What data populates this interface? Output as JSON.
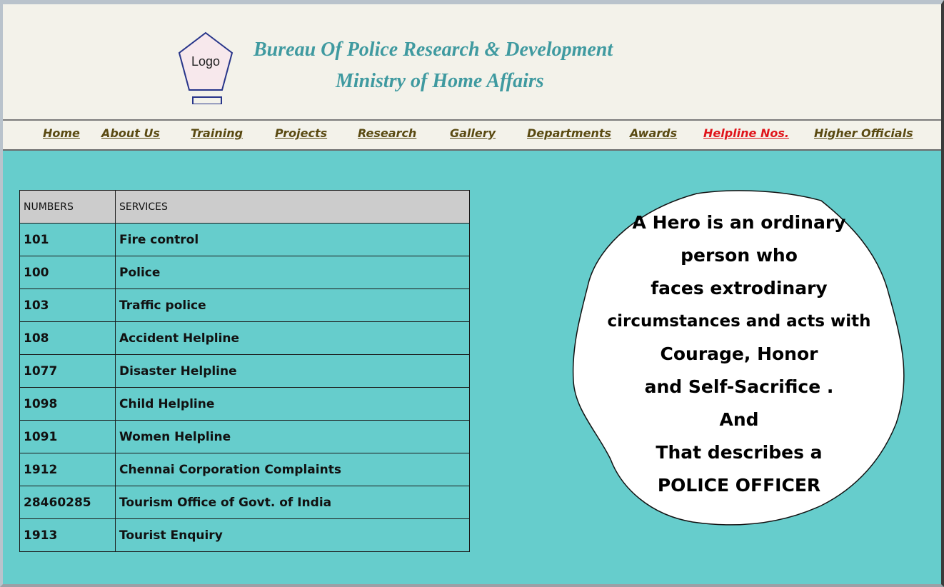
{
  "header": {
    "logo_text": "Logo",
    "title_line1": "Bureau Of Police Research & Development",
    "title_line2": "Ministry of Home Affairs"
  },
  "nav": {
    "items": [
      "Home",
      "About Us",
      "Training",
      "Projects",
      "Research",
      "Gallery",
      "Departments",
      "Awards",
      "Helpline Nos.",
      "Higher Officials"
    ],
    "active": "Helpline Nos."
  },
  "table": {
    "headers": [
      "NUMBERS",
      "SERVICES"
    ],
    "rows": [
      [
        "101",
        "Fire control"
      ],
      [
        "100",
        "Police"
      ],
      [
        "103",
        "Traffic police"
      ],
      [
        "108",
        "Accident Helpline"
      ],
      [
        "1077",
        "Disaster Helpline"
      ],
      [
        "1098",
        "Child Helpline"
      ],
      [
        "1091",
        "Women Helpline"
      ],
      [
        "1912",
        "Chennai Corporation Complaints"
      ],
      [
        "28460285",
        "Tourism Office of Govt. of India"
      ],
      [
        "1913",
        "Tourist Enquiry"
      ]
    ]
  },
  "quote": {
    "lines": [
      "A Hero is an ordinary",
      "person who",
      "faces extrodinary",
      "circumstances and acts with",
      "Courage, Honor",
      "and  Self-Sacrifice .",
      "And",
      "That describes a",
      "POLICE OFFICER"
    ]
  },
  "colors": {
    "background": "#66cdcc",
    "header_bg": "#f3f2ea",
    "title": "#3f9aa0",
    "nav_link": "#5a4a12",
    "nav_active": "#e0151b",
    "table_header_bg": "#cccccc"
  }
}
